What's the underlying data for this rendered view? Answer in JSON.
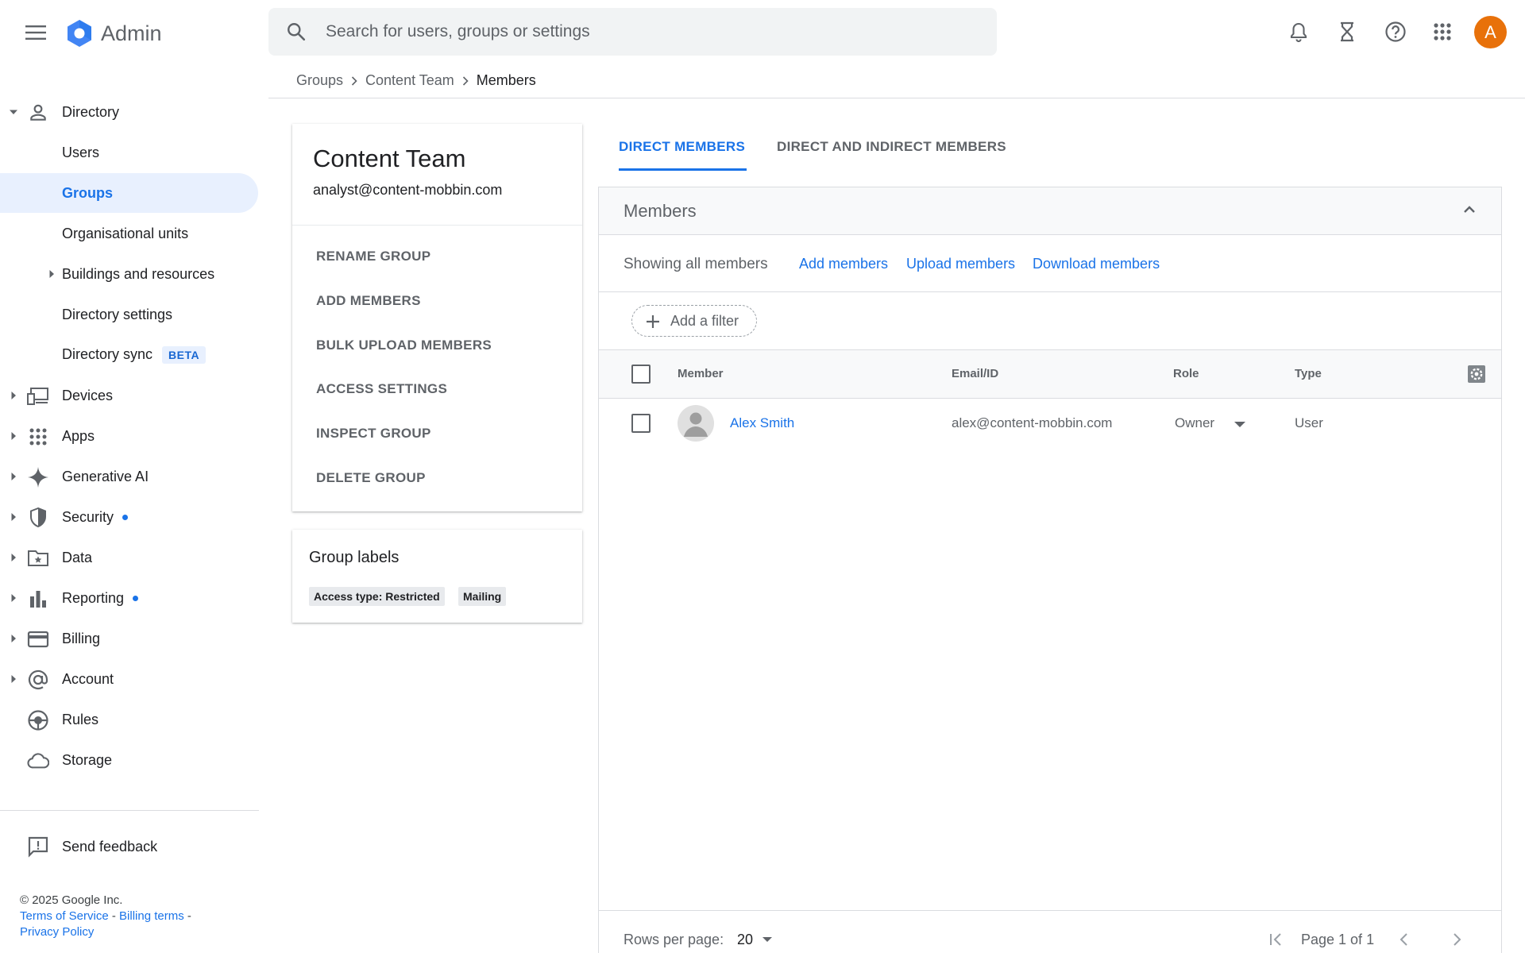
{
  "app": {
    "name": "Admin",
    "avatar_letter": "A",
    "brand_color": "#4285f4",
    "avatar_color": "#e8710a"
  },
  "search": {
    "placeholder": "Search for users, groups or settings"
  },
  "top_icons": [
    "notifications-icon",
    "hourglass-icon",
    "help-icon",
    "apps-grid-icon"
  ],
  "breadcrumb": {
    "items": [
      "Groups",
      "Content Team"
    ],
    "current": "Members"
  },
  "sidebar": {
    "items": [
      {
        "label": "Directory",
        "icon": "person-icon"
      },
      {
        "label": "Users"
      },
      {
        "label": "Groups"
      },
      {
        "label": "Organisational units"
      },
      {
        "label": "Buildings and resources"
      },
      {
        "label": "Directory settings"
      },
      {
        "label": "Directory sync",
        "badge": "BETA"
      },
      {
        "label": "Devices",
        "icon": "devices-icon"
      },
      {
        "label": "Apps",
        "icon": "apps-icon"
      },
      {
        "label": "Generative AI",
        "icon": "sparkle-icon"
      },
      {
        "label": "Security",
        "icon": "shield-icon"
      },
      {
        "label": "Data",
        "icon": "folder-star-icon"
      },
      {
        "label": "Reporting",
        "icon": "bar-chart-icon"
      },
      {
        "label": "Billing",
        "icon": "credit-card-icon"
      },
      {
        "label": "Account",
        "icon": "at-sign-icon"
      },
      {
        "label": "Rules",
        "icon": "rules-icon"
      },
      {
        "label": "Storage",
        "icon": "cloud-icon"
      }
    ],
    "feedback": "Send feedback",
    "footer": {
      "copyright": "© 2025 Google Inc.",
      "terms": "Terms of Service",
      "billing_terms": "Billing terms",
      "privacy": "Privacy Policy",
      "sep": " - "
    }
  },
  "group": {
    "title": "Content Team",
    "email": "analyst@content-mobbin.com",
    "actions": [
      "RENAME GROUP",
      "ADD MEMBERS",
      "BULK UPLOAD MEMBERS",
      "ACCESS SETTINGS",
      "INSPECT GROUP",
      "DELETE GROUP"
    ],
    "labels_title": "Group labels",
    "labels": [
      "Access type: Restricted",
      "Mailing"
    ]
  },
  "tabs": [
    "DIRECT MEMBERS",
    "DIRECT AND INDIRECT MEMBERS"
  ],
  "members": {
    "title": "Members",
    "showing": "Showing all members",
    "actions": [
      "Add members",
      "Upload members",
      "Download members"
    ],
    "filter": "Add a filter",
    "columns": [
      "Member",
      "Email/ID",
      "Role",
      "Type"
    ],
    "rows": [
      {
        "name": "Alex Smith",
        "email": "alex@content-mobbin.com",
        "role": "Owner",
        "type": "User"
      }
    ],
    "pagination": {
      "rows_label": "Rows per page:",
      "rows_value": "20",
      "page_info": "Page 1 of 1"
    }
  }
}
